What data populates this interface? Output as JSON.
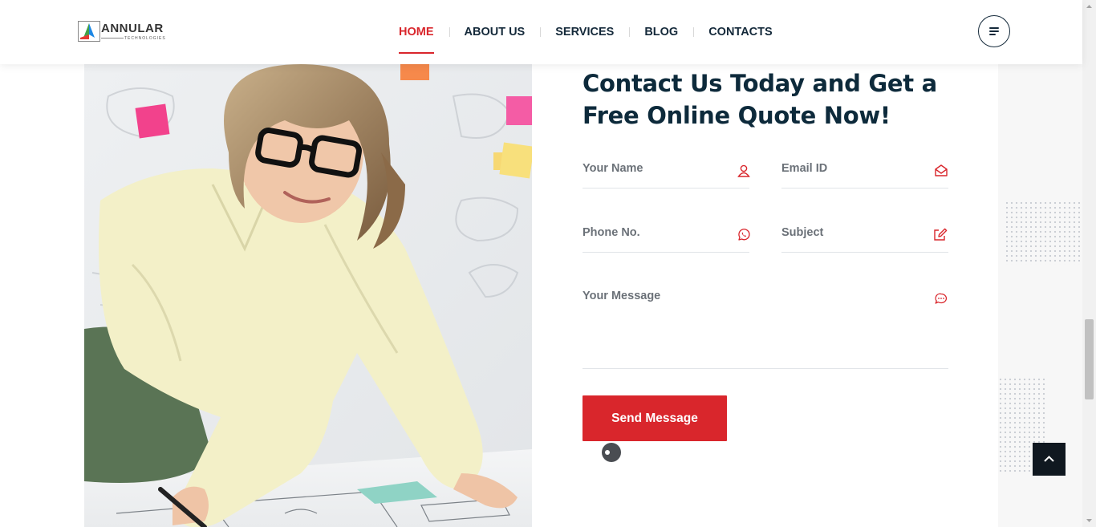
{
  "brand": {
    "name": "ANNULAR",
    "tagline": "TECHNOLOGIES",
    "colors": {
      "accent": "#d9262c",
      "navy": "#0d2a3b",
      "logo_blue": "#1e88e5",
      "logo_green": "#43a047",
      "logo_red": "#e53935"
    }
  },
  "nav": {
    "items": [
      {
        "label": "HOME",
        "active": true
      },
      {
        "label": "ABOUT US",
        "active": false
      },
      {
        "label": "SERVICES",
        "active": false
      },
      {
        "label": "BLOG",
        "active": false
      },
      {
        "label": "CONTACTS",
        "active": false
      }
    ],
    "menu_icon": "hamburger-icon"
  },
  "contact": {
    "title": "Contact Us Today and Get a Free Online Quote Now!",
    "fields": {
      "name": {
        "placeholder": "Your Name",
        "icon": "user-icon"
      },
      "email": {
        "placeholder": "Email ID",
        "icon": "envelope-open-icon"
      },
      "phone": {
        "placeholder": "Phone No.",
        "icon": "whatsapp-icon"
      },
      "subject": {
        "placeholder": "Subject",
        "icon": "edit-icon"
      },
      "message": {
        "placeholder": "Your Message",
        "icon": "chat-bubble-icon"
      }
    },
    "submit_label": "Send Message"
  },
  "floating": {
    "back_to_top_icon": "chevron-up-icon",
    "toggle_icon": "toggle-icon"
  }
}
